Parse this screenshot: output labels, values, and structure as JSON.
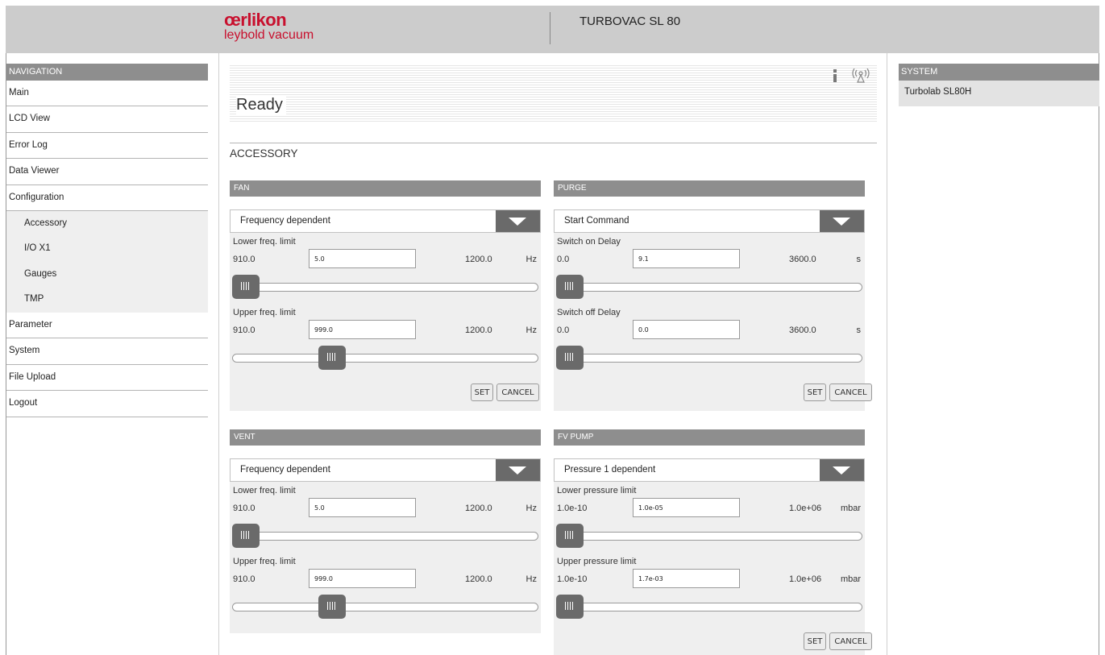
{
  "header": {
    "brand_name": "œrlikon",
    "brand_sub": "leybold vacuum",
    "device_title": "TURBOVAC SL 80"
  },
  "navigation": {
    "heading": "NAVIGATION",
    "items_top": [
      "Main",
      "LCD View",
      "Error Log",
      "Data Viewer",
      "Configuration"
    ],
    "sub_items": [
      "Accessory",
      "I/O X1",
      "Gauges",
      "TMP"
    ],
    "items_bottom": [
      "Parameter",
      "System",
      "File Upload",
      "Logout"
    ]
  },
  "system": {
    "heading": "SYSTEM",
    "device": "Turbolab SL80H"
  },
  "status": {
    "text": "Ready",
    "icons": [
      "info-icon",
      "wireless-icon"
    ]
  },
  "section": {
    "title": "ACCESSORY"
  },
  "buttons": {
    "set": "SET",
    "cancel": "CANCEL"
  },
  "panels": {
    "fan": {
      "title": "FAN",
      "mode": "Frequency dependent",
      "lower": {
        "label": "Lower freq. limit",
        "min": "910.0",
        "value": "5.0",
        "max": "1200.0",
        "unit": "Hz",
        "position": 0.0
      },
      "upper": {
        "label": "Upper freq. limit",
        "min": "910.0",
        "value": "999.0",
        "max": "1200.0",
        "unit": "Hz",
        "position": 0.31
      }
    },
    "purge": {
      "title": "PURGE",
      "mode": "Start Command",
      "lower": {
        "label": "Switch on Delay",
        "min": "0.0",
        "value": "9.1",
        "max": "3600.0",
        "unit": "s",
        "position": 0.0
      },
      "upper": {
        "label": "Switch off Delay",
        "min": "0.0",
        "value": "0.0",
        "max": "3600.0",
        "unit": "s",
        "position": 0.0
      }
    },
    "vent": {
      "title": "VENT",
      "mode": "Frequency dependent",
      "lower": {
        "label": "Lower freq. limit",
        "min": "910.0",
        "value": "5.0",
        "max": "1200.0",
        "unit": "Hz",
        "position": 0.0
      },
      "upper": {
        "label": "Upper freq. limit",
        "min": "910.0",
        "value": "999.0",
        "max": "1200.0",
        "unit": "Hz",
        "position": 0.31
      }
    },
    "fv_pump": {
      "title": "FV PUMP",
      "mode": "Pressure 1 dependent",
      "lower": {
        "label": "Lower pressure limit",
        "min": "1.0e-10",
        "value": "1.0e-05",
        "max": "1.0e+06",
        "unit": "mbar",
        "position": 0.0
      },
      "upper": {
        "label": "Upper pressure limit",
        "min": "1.0e-10",
        "value": "1.7e-03",
        "max": "1.0e+06",
        "unit": "mbar",
        "position": 0.0
      }
    }
  }
}
